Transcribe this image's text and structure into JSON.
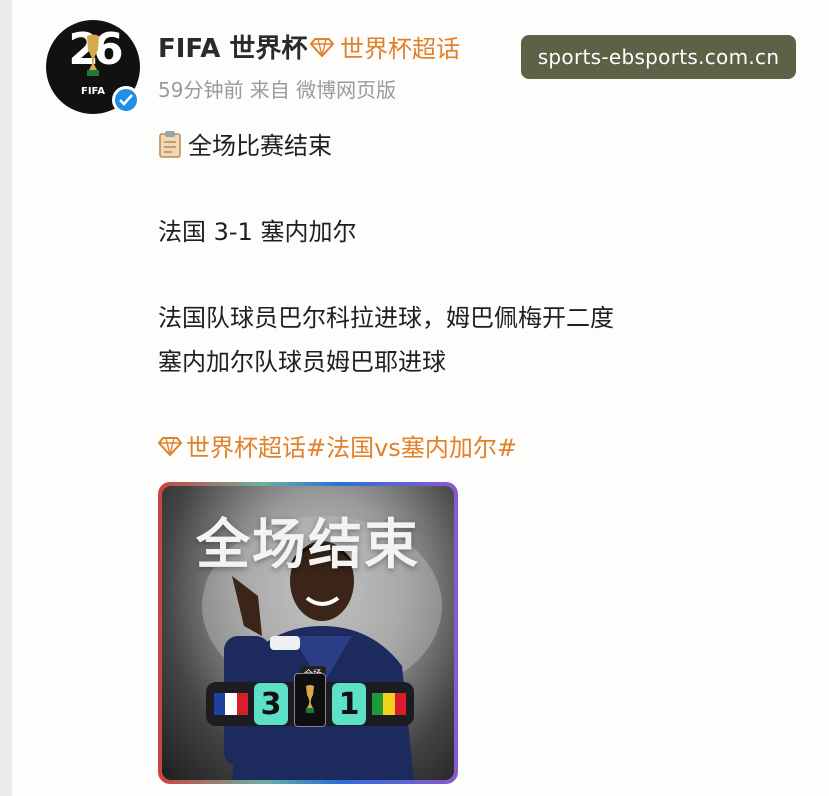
{
  "post": {
    "username": "FIFA 世界杯",
    "topic": "世界杯超话",
    "meta": "59分钟前  来自 微博网页版",
    "avatar": {
      "top_text": "26",
      "label": "FIFA"
    },
    "lines": [
      "全场比赛结束",
      "法国 3-1 塞内加尔",
      "法国队球员巴尔科拉进球，姆巴佩梅开二度",
      "塞内加尔队球员姆巴耶进球"
    ],
    "hashtags": "世界杯超话#法国vs塞内加尔#",
    "icons": {
      "avatar": "fifa-world-cup-2026-logo",
      "verified": "verified-badge-icon",
      "topic": "diamond-icon",
      "clipboard": "clipboard-icon"
    }
  },
  "watermark": "sports-ebsports.com.cn",
  "media": {
    "title": "全场结束",
    "status": "全场",
    "home_score": "3",
    "away_score": "1",
    "home_flag_colors": [
      "#1f3fa0",
      "#ffffff",
      "#d81e2c"
    ],
    "away_flag_colors": [
      "#1f9a3a",
      "#f3d21b",
      "#d81e2c"
    ]
  },
  "colors": {
    "accent": "#e2812b",
    "verified": "#1e8ee6",
    "watermark_bg": "#5d6247"
  }
}
